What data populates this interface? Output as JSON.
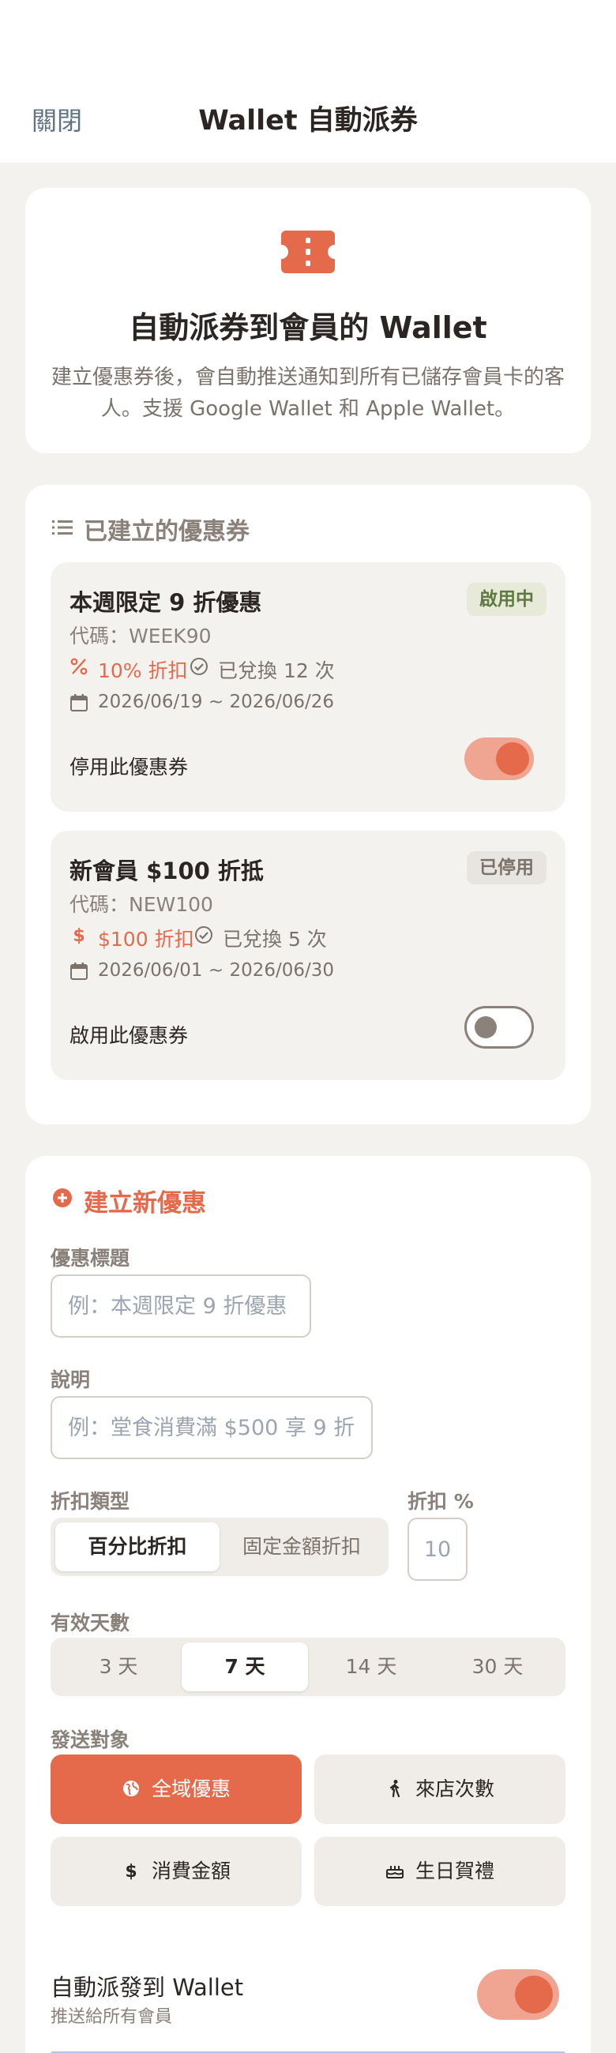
{
  "header": {
    "close_label": "關閉",
    "title": "Wallet 自動派券"
  },
  "hero": {
    "icon": "ticket-icon",
    "title": "自動派券到會員的 Wallet",
    "description": "建立優惠券後，會自動推送通知到所有已儲存會員卡的客人。支援 Google Wallet 和 Apple Wallet。"
  },
  "coupons_section": {
    "title": "已建立的優惠券",
    "icon": "list-icon",
    "items": [
      {
        "title": "本週限定 9 折優惠",
        "badge": "啟用中",
        "code": "代碼：WEEK90",
        "discount": "10% 折扣",
        "discount_icon": "percent-icon",
        "redeemed": "已兌換 12 次",
        "period": "2026/06/19 ~ 2026/06/26",
        "toggle_label": "停用此優惠券",
        "enabled": true
      },
      {
        "title": "新會員 $100 折抵",
        "badge": "已停用",
        "code": "代碼：NEW100",
        "discount": "$100 折扣",
        "discount_icon": "dollar-icon",
        "redeemed": "已兌換 5 次",
        "period": "2026/06/01 ~ 2026/06/30",
        "toggle_label": "啟用此優惠券",
        "enabled": false
      }
    ]
  },
  "create_section": {
    "title": "建立新優惠",
    "title_label": "優惠標題",
    "title_placeholder": "例：本週限定 9 折優惠",
    "desc_label": "說明",
    "desc_placeholder": "例：堂食消費滿 $500 享 9 折",
    "discount_type_label": "折扣類型",
    "discount_types": [
      "百分比折扣",
      "固定金額折扣"
    ],
    "selected_discount_type": "百分比折扣",
    "discount_pct_label": "折扣 %",
    "discount_pct_placeholder": "10",
    "days_label": "有效天數",
    "days_options": [
      "3 天",
      "7 天",
      "14 天",
      "30 天"
    ],
    "selected_days": "7 天",
    "target_label": "發送對象",
    "targets": [
      {
        "label": "全域優惠",
        "icon": "globe-icon",
        "selected": true
      },
      {
        "label": "來店次數",
        "icon": "walking-icon",
        "selected": false
      },
      {
        "label": "消費金額",
        "icon": "dollar-icon",
        "selected": false
      },
      {
        "label": "生日賀禮",
        "icon": "cake-icon",
        "selected": false
      }
    ],
    "auto_label": "自動派發到 Wallet",
    "auto_sub": "推送給所有會員",
    "auto_enabled": true
  },
  "colors": {
    "accent": "#e56a4c",
    "accent_light": "#f0a592",
    "background": "#f4f2ef",
    "badge_active": "#5f7a40"
  }
}
